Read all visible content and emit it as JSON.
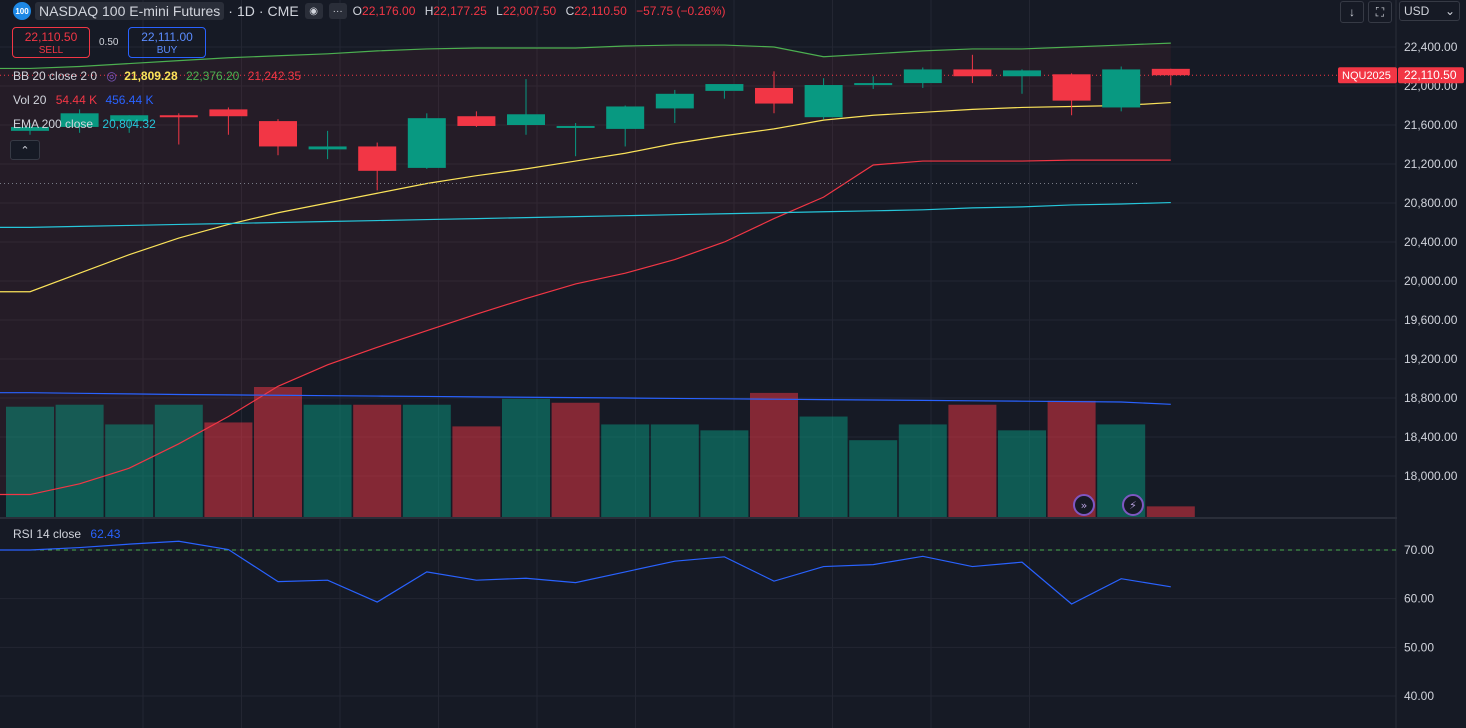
{
  "header": {
    "logo_text": "100",
    "symbol": "NASDAQ 100 E-mini Futures",
    "timeframe": "1D",
    "exchange": "CME",
    "ohlc": {
      "o_label": "O",
      "o": "22,176.00",
      "h_label": "H",
      "h": "22,177.25",
      "l_label": "L",
      "l": "22,007.50",
      "c_label": "C",
      "c": "22,110.50",
      "change": "−57.75 (−0.26%)"
    },
    "icons": [
      "eye-off-icon",
      "more-options-icon"
    ]
  },
  "trade": {
    "sell_price": "22,110.50",
    "sell_label": "SELL",
    "spread": "0.50",
    "buy_price": "22,111.00",
    "buy_label": "BUY"
  },
  "indicators": {
    "bb": {
      "name": "BB 20 close 2 0",
      "basis": "21,809.28",
      "upper": "22,376.20",
      "lower": "21,242.35"
    },
    "vol": {
      "name": "Vol 20",
      "value": "54.44 K",
      "ma": "456.44 K"
    },
    "ema": {
      "name": "EMA 200 close",
      "value": "20,804.32"
    },
    "rsi": {
      "name": "RSI 14 close",
      "value": "62.43"
    }
  },
  "toolbar": {
    "currency": "USD",
    "currency_icon": "chevron-down-icon",
    "scroll_icon": "arrow-down-icon",
    "fit_icon": "fit-screen-icon"
  },
  "price_tag": {
    "symbol": "NQU2025",
    "price": "22,110.50"
  },
  "colors": {
    "up": "#089981",
    "down": "#f23645",
    "bb_upper": "#4caf50",
    "bb_basis": "#fbe35a",
    "bb_lower": "#f23645",
    "ema": "#26c6da",
    "vol_ma": "#2962ff",
    "rsi": "#2962ff",
    "bg": "#161a25",
    "grid": "#232632"
  },
  "chart_data": [
    {
      "type": "candlestick",
      "title": "NASDAQ 100 E-mini Futures · 1D · CME",
      "ylim": [
        17800,
        22600
      ],
      "y_ticks": [
        "22,400.00",
        "22,000.00",
        "21,600.00",
        "21,200.00",
        "20,800.00",
        "20,400.00",
        "20,000.00",
        "19,600.00",
        "19,200.00",
        "18,800.00",
        "18,400.00",
        "18,000.00"
      ],
      "y_tick_values": [
        22400,
        22000,
        21600,
        21200,
        20800,
        20400,
        20000,
        19600,
        19200,
        18800,
        18400,
        18000
      ],
      "candles": [
        {
          "o": 21540,
          "h": 21620,
          "l": 21500,
          "c": 21580
        },
        {
          "o": 21580,
          "h": 21760,
          "l": 21520,
          "c": 21720
        },
        {
          "o": 21640,
          "h": 21700,
          "l": 21520,
          "c": 21700
        },
        {
          "o": 21700,
          "h": 21720,
          "l": 21400,
          "c": 21690
        },
        {
          "o": 21760,
          "h": 21780,
          "l": 21500,
          "c": 21690
        },
        {
          "o": 21640,
          "h": 21660,
          "l": 21290,
          "c": 21380
        },
        {
          "o": 21350,
          "h": 21540,
          "l": 21250,
          "c": 21380
        },
        {
          "o": 21380,
          "h": 21420,
          "l": 20930,
          "c": 21130
        },
        {
          "o": 21160,
          "h": 21720,
          "l": 21150,
          "c": 21670
        },
        {
          "o": 21690,
          "h": 21740,
          "l": 21580,
          "c": 21590
        },
        {
          "o": 21600,
          "h": 22070,
          "l": 21500,
          "c": 21710
        },
        {
          "o": 21590,
          "h": 21620,
          "l": 21280,
          "c": 21590
        },
        {
          "o": 21560,
          "h": 21800,
          "l": 21380,
          "c": 21790
        },
        {
          "o": 21770,
          "h": 21960,
          "l": 21620,
          "c": 21920
        },
        {
          "o": 21950,
          "h": 22010,
          "l": 21870,
          "c": 22020
        },
        {
          "o": 21980,
          "h": 22150,
          "l": 21720,
          "c": 21820
        },
        {
          "o": 21680,
          "h": 22080,
          "l": 21660,
          "c": 22010
        },
        {
          "o": 22010,
          "h": 22100,
          "l": 21970,
          "c": 22030
        },
        {
          "o": 22030,
          "h": 22190,
          "l": 21980,
          "c": 22170
        },
        {
          "o": 22170,
          "h": 22320,
          "l": 22030,
          "c": 22100
        },
        {
          "o": 22100,
          "h": 22170,
          "l": 21920,
          "c": 22160
        },
        {
          "o": 22120,
          "h": 22130,
          "l": 21700,
          "c": 21850
        },
        {
          "o": 21780,
          "h": 22200,
          "l": 21740,
          "c": 22170
        },
        {
          "o": 22176,
          "h": 22177.25,
          "l": 22007.5,
          "c": 22110.5
        }
      ],
      "bb_upper": [
        22180,
        22200,
        22230,
        22260,
        22290,
        22310,
        22330,
        22360,
        22380,
        22390,
        22390,
        22390,
        22410,
        22420,
        22420,
        22400,
        22300,
        22330,
        22360,
        22380,
        22380,
        22400,
        22420,
        22440
      ],
      "bb_basis": [
        19890,
        20080,
        20270,
        20440,
        20580,
        20700,
        20800,
        20900,
        21000,
        21080,
        21150,
        21230,
        21310,
        21410,
        21490,
        21560,
        21650,
        21700,
        21730,
        21760,
        21780,
        21790,
        21800,
        21830
      ],
      "bb_lower": [
        17810,
        17920,
        18080,
        18330,
        18610,
        18920,
        19140,
        19320,
        19490,
        19660,
        19820,
        19970,
        20080,
        20220,
        20400,
        20640,
        20860,
        21190,
        21230,
        21230,
        21230,
        21240,
        21240,
        21240
      ],
      "ema": [
        20550,
        20560,
        20570,
        20580,
        20590,
        20600,
        20610,
        20620,
        20630,
        20640,
        20650,
        20660,
        20670,
        20680,
        20690,
        20700,
        20710,
        20720,
        20730,
        20750,
        20760,
        20780,
        20790,
        20804.32
      ]
    },
    {
      "type": "bar",
      "name": "Vol 20",
      "values": [
        560,
        570,
        470,
        570,
        480,
        660,
        570,
        570,
        570,
        460,
        600,
        580,
        470,
        470,
        440,
        630,
        510,
        390,
        470,
        570,
        440,
        590,
        470,
        54
      ],
      "up": [
        true,
        true,
        true,
        true,
        false,
        false,
        true,
        false,
        true,
        false,
        true,
        false,
        true,
        true,
        true,
        false,
        true,
        true,
        true,
        false,
        true,
        false,
        true,
        false
      ],
      "ma": [
        631,
        628,
        625,
        622,
        620,
        618,
        616,
        614,
        612,
        610,
        608,
        606,
        604,
        602,
        600,
        598,
        596,
        594,
        592,
        590,
        588,
        586,
        584,
        572
      ]
    },
    {
      "type": "line",
      "name": "RSI 14 close",
      "ylim": [
        37,
        73
      ],
      "y_ticks": [
        "70.00",
        "60.00",
        "50.00",
        "40.00"
      ],
      "y_tick_values": [
        70,
        60,
        50,
        40
      ],
      "overbought": 70,
      "values": [
        70.0,
        70.5,
        71.2,
        71.8,
        70.1,
        63.5,
        63.8,
        59.3,
        65.5,
        63.8,
        64.2,
        63.3,
        65.5,
        67.7,
        68.6,
        63.6,
        66.6,
        67.0,
        68.7,
        66.6,
        67.5,
        58.9,
        64.1,
        62.43
      ]
    }
  ]
}
